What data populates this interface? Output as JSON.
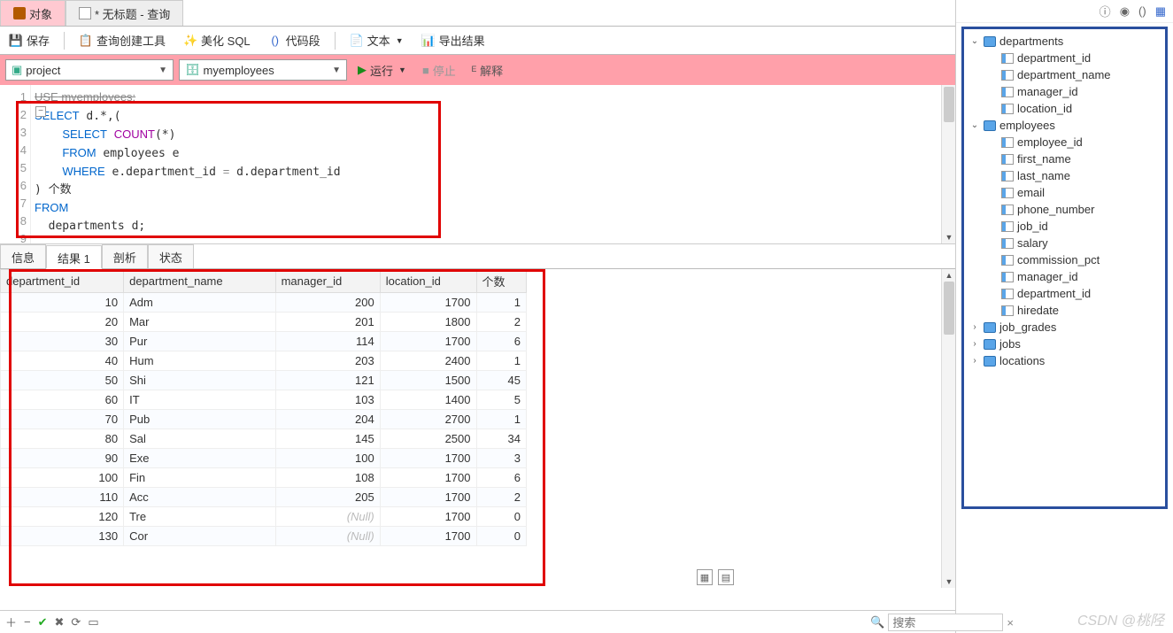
{
  "tabs": {
    "objects": "对象",
    "query": "* 无标题 - 查询"
  },
  "toolbar": {
    "save": "保存",
    "builder": "查询创建工具",
    "beautify": "美化 SQL",
    "snippet": "代码段",
    "text": "文本",
    "export": "导出结果"
  },
  "conn": {
    "project": "project",
    "database": "myemployees",
    "run": "运行",
    "stop": "停止",
    "explain": "解释"
  },
  "editor": {
    "lines": [
      "USE myemployees;",
      "SELECT d.*,(",
      "    SELECT COUNT(*)",
      "    FROM employees e",
      "    WHERE e.department_id = d.department_id",
      ") 个数",
      "FROM",
      "  departments d;"
    ]
  },
  "result_tabs": {
    "info": "信息",
    "result1": "结果 1",
    "profile": "剖析",
    "status": "状态"
  },
  "columns": [
    "department_id",
    "department_name",
    "manager_id",
    "location_id",
    "个数"
  ],
  "rows": [
    {
      "department_id": 10,
      "department_name": "Adm",
      "manager_id": 200,
      "location_id": 1700,
      "count": 1
    },
    {
      "department_id": 20,
      "department_name": "Mar",
      "manager_id": 201,
      "location_id": 1800,
      "count": 2
    },
    {
      "department_id": 30,
      "department_name": "Pur",
      "manager_id": 114,
      "location_id": 1700,
      "count": 6
    },
    {
      "department_id": 40,
      "department_name": "Hum",
      "manager_id": 203,
      "location_id": 2400,
      "count": 1
    },
    {
      "department_id": 50,
      "department_name": "Shi",
      "manager_id": 121,
      "location_id": 1500,
      "count": 45
    },
    {
      "department_id": 60,
      "department_name": "IT",
      "manager_id": 103,
      "location_id": 1400,
      "count": 5
    },
    {
      "department_id": 70,
      "department_name": "Pub",
      "manager_id": 204,
      "location_id": 2700,
      "count": 1
    },
    {
      "department_id": 80,
      "department_name": "Sal",
      "manager_id": 145,
      "location_id": 2500,
      "count": 34
    },
    {
      "department_id": 90,
      "department_name": "Exe",
      "manager_id": 100,
      "location_id": 1700,
      "count": 3
    },
    {
      "department_id": 100,
      "department_name": "Fin",
      "manager_id": 108,
      "location_id": 1700,
      "count": 6
    },
    {
      "department_id": 110,
      "department_name": "Acc",
      "manager_id": 205,
      "location_id": 1700,
      "count": 2
    },
    {
      "department_id": 120,
      "department_name": "Tre",
      "manager_id": null,
      "location_id": 1700,
      "count": 0
    },
    {
      "department_id": 130,
      "department_name": "Cor",
      "manager_id": null,
      "location_id": 1700,
      "count": 0
    }
  ],
  "null_text": "(Null)",
  "tree": [
    {
      "level": 0,
      "exp": "v",
      "type": "table",
      "label": "departments"
    },
    {
      "level": 1,
      "type": "col",
      "label": "department_id"
    },
    {
      "level": 1,
      "type": "col",
      "label": "department_name"
    },
    {
      "level": 1,
      "type": "col",
      "label": "manager_id"
    },
    {
      "level": 1,
      "type": "col",
      "label": "location_id"
    },
    {
      "level": 0,
      "exp": "v",
      "type": "table",
      "label": "employees"
    },
    {
      "level": 1,
      "type": "col",
      "label": "employee_id"
    },
    {
      "level": 1,
      "type": "col",
      "label": "first_name"
    },
    {
      "level": 1,
      "type": "col",
      "label": "last_name"
    },
    {
      "level": 1,
      "type": "col",
      "label": "email"
    },
    {
      "level": 1,
      "type": "col",
      "label": "phone_number"
    },
    {
      "level": 1,
      "type": "col",
      "label": "job_id"
    },
    {
      "level": 1,
      "type": "col",
      "label": "salary"
    },
    {
      "level": 1,
      "type": "col",
      "label": "commission_pct"
    },
    {
      "level": 1,
      "type": "col",
      "label": "manager_id"
    },
    {
      "level": 1,
      "type": "col",
      "label": "department_id"
    },
    {
      "level": 1,
      "type": "col",
      "label": "hiredate"
    },
    {
      "level": 0,
      "exp": ">",
      "type": "table",
      "label": "job_grades"
    },
    {
      "level": 0,
      "exp": ">",
      "type": "table",
      "label": "jobs"
    },
    {
      "level": 0,
      "exp": ">",
      "type": "table",
      "label": "locations"
    }
  ],
  "search_placeholder": "搜索",
  "watermark": "CSDN @桃陉"
}
